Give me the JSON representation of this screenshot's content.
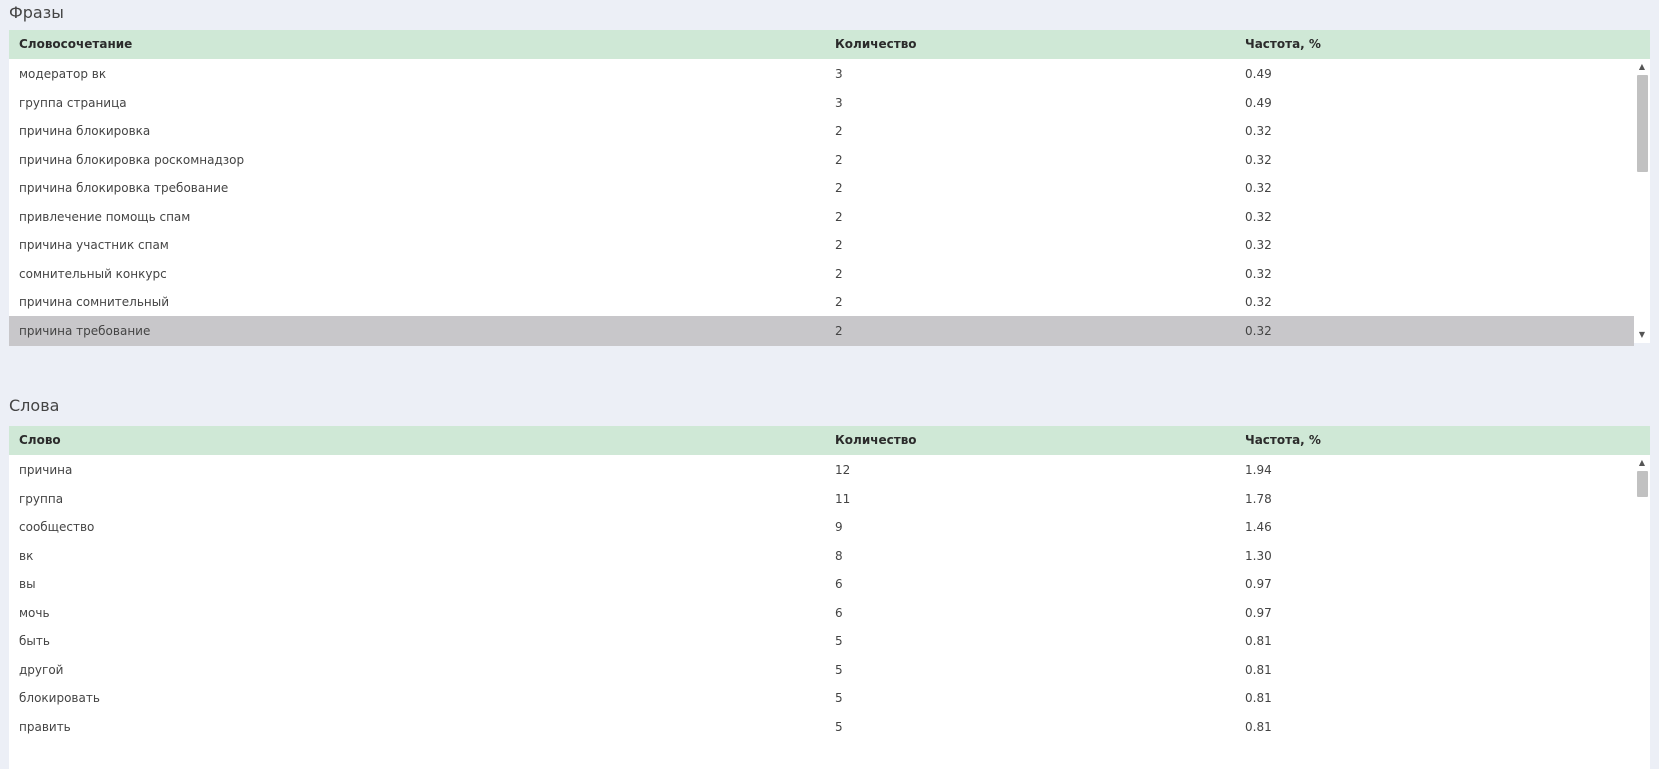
{
  "phrases": {
    "title": "Фразы",
    "columns": [
      "Словосочетание",
      "Количество",
      "Частота, %"
    ],
    "rows": [
      [
        "модератор вк",
        "3",
        "0.49"
      ],
      [
        "группа страница",
        "3",
        "0.49"
      ],
      [
        "причина блокировка",
        "2",
        "0.32"
      ],
      [
        "причина блокировка роскомнадзор",
        "2",
        "0.32"
      ],
      [
        "причина блокировка требование",
        "2",
        "0.32"
      ],
      [
        "привлечение помощь спам",
        "2",
        "0.32"
      ],
      [
        "причина участник спам",
        "2",
        "0.32"
      ],
      [
        "сомнительный конкурс",
        "2",
        "0.32"
      ],
      [
        "причина сомнительный",
        "2",
        "0.32"
      ],
      [
        "причина требование",
        "2",
        "0.32"
      ]
    ],
    "selected_row_index": 9
  },
  "words": {
    "title": "Слова",
    "columns": [
      "Слово",
      "Количество",
      "Частота, %"
    ],
    "rows": [
      [
        "причина",
        "12",
        "1.94"
      ],
      [
        "группа",
        "11",
        "1.78"
      ],
      [
        "сообщество",
        "9",
        "1.46"
      ],
      [
        "вк",
        "8",
        "1.30"
      ],
      [
        "вы",
        "6",
        "0.97"
      ],
      [
        "мочь",
        "6",
        "0.97"
      ],
      [
        "быть",
        "5",
        "0.81"
      ],
      [
        "другой",
        "5",
        "0.81"
      ],
      [
        "блокировать",
        "5",
        "0.81"
      ],
      [
        "править",
        "5",
        "0.81"
      ]
    ]
  },
  "icons": {
    "scroll_up": "▲",
    "scroll_down": "▼"
  },
  "colors": {
    "header_bg": "#cfe8d6",
    "selected_row_bg": "#c8c7ca",
    "page_bg": "#eceff6"
  }
}
